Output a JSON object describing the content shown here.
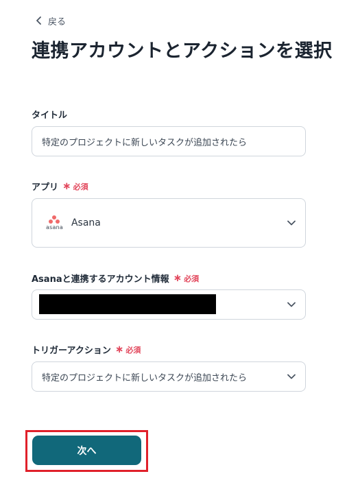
{
  "back": {
    "label": "戻る"
  },
  "page_title": "連携アカウントとアクションを選択",
  "required_label": "必須",
  "fields": {
    "title": {
      "label": "タイトル",
      "value": "特定のプロジェクトに新しいタスクが追加されたら"
    },
    "app": {
      "label": "アプリ",
      "value": "Asana",
      "logo_text": "asana"
    },
    "account": {
      "label": "Asanaと連携するアカウント情報",
      "value": ""
    },
    "trigger": {
      "label": "トリガーアクション",
      "value": "特定のプロジェクトに新しいタスクが追加されたら"
    }
  },
  "next_button": {
    "label": "次へ"
  },
  "colors": {
    "primary": "#11687a",
    "required": "#e2475c",
    "highlight": "#e0202a",
    "asana": "#f06a6a"
  }
}
